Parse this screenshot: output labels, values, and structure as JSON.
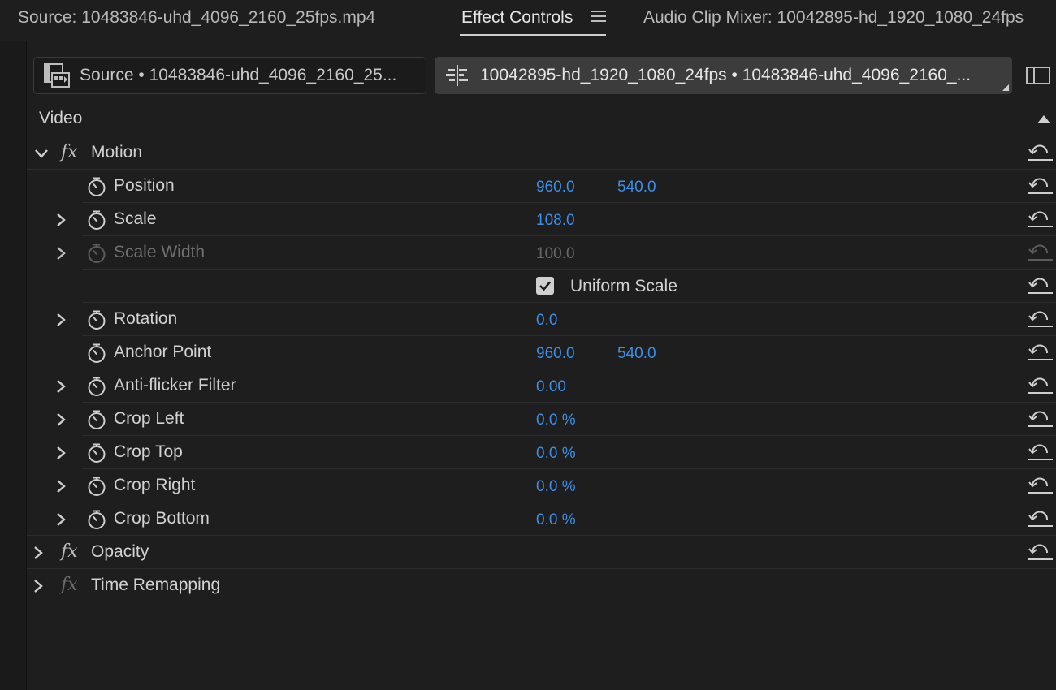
{
  "tabs": {
    "source": "Source: 10483846-uhd_4096_2160_25fps.mp4",
    "effect_controls": "Effect Controls",
    "audio_mixer": "Audio Clip Mixer: 10042895-hd_1920_1080_24fps"
  },
  "clip_header": {
    "source_clip": "Source • 10483846-uhd_4096_2160_25...",
    "sequence_clip": "10042895-hd_1920_1080_24fps • 10483846-uhd_4096_2160_..."
  },
  "section": {
    "video": "Video"
  },
  "effects": {
    "motion": "Motion",
    "opacity": "Opacity",
    "time_remapping": "Time Remapping"
  },
  "properties": [
    {
      "label": "Position",
      "value1": "960.0",
      "value2": "540.0"
    },
    {
      "label": "Scale",
      "value1": "108.0"
    },
    {
      "label": "Scale Width",
      "value1": "100.0"
    },
    {
      "label": "Uniform Scale",
      "checked": true
    },
    {
      "label": "Rotation",
      "value1": "0.0"
    },
    {
      "label": "Anchor Point",
      "value1": "960.0",
      "value2": "540.0"
    },
    {
      "label": "Anti-flicker Filter",
      "value1": "0.00"
    },
    {
      "label": "Crop Left",
      "value1": "0.0 %"
    },
    {
      "label": "Crop Top",
      "value1": "0.0 %"
    },
    {
      "label": "Crop Right",
      "value1": "0.0 %"
    },
    {
      "label": "Crop Bottom",
      "value1": "0.0 %"
    }
  ],
  "colors": {
    "value_blue": "#3b8fe8",
    "panel_bg": "#1e1e1e",
    "text": "#d2d2d2"
  },
  "icons": [
    "menu-icon",
    "source-clip-icon",
    "sequence-icon",
    "panel-toggle-icon",
    "scroll-up-icon",
    "chevron-icon",
    "fx-icon",
    "stopwatch-icon",
    "reset-icon",
    "checkbox-icon"
  ]
}
